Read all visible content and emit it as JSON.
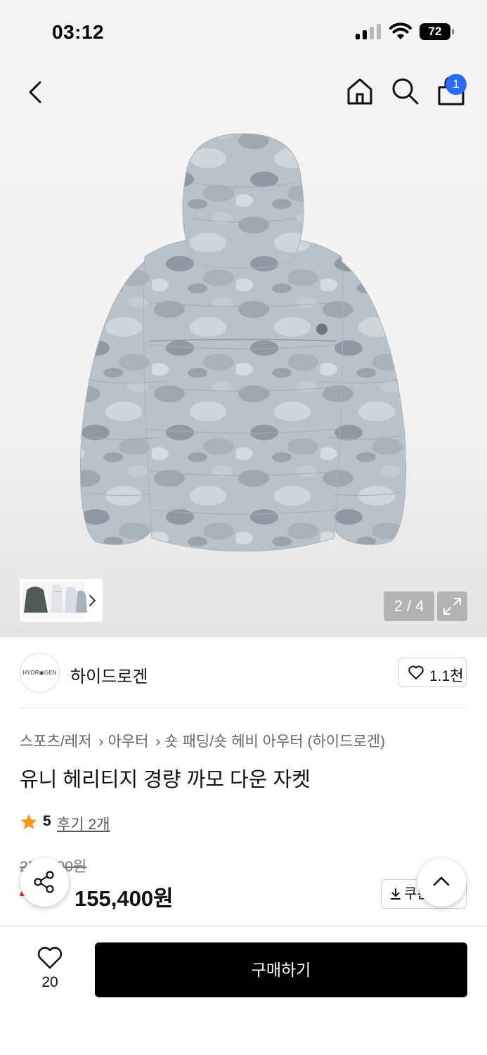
{
  "status_bar": {
    "time": "03:12",
    "battery": "72",
    "icons": [
      "signal-icon",
      "wifi-icon",
      "battery-icon"
    ]
  },
  "nav": {
    "icons": [
      "back-chevron-icon",
      "home-icon",
      "search-icon",
      "shopping-bag-icon"
    ],
    "cart_badge": "1"
  },
  "gallery": {
    "counter": "2 / 4",
    "thumb_icon": "chevron-right-icon",
    "expand_icon": "expand-icon"
  },
  "brand": {
    "logo_text": "HYDR◉GEN",
    "name": "하이드로겐",
    "likes": "1.1천"
  },
  "product": {
    "breadcrumb": [
      "스포츠/레저",
      "아우터",
      "숏 패딩/숏 헤비 아우터 (하이드로겐)"
    ],
    "title": "유니 헤리티지 경량 까모 다운 자켓",
    "rating": "5",
    "reviews": "후기 2개",
    "original_price": "259,000원",
    "discount": "40%",
    "sale_price": "155,400원",
    "coupon_label": "쿠폰 받기"
  },
  "bottom_bar": {
    "wish_count": "20",
    "buy_label": "구매하기"
  },
  "colors": {
    "cart_badge": "#2b6bff",
    "discount": "#e0301e",
    "star": "#f59a1a",
    "buy_button": "#000000"
  }
}
